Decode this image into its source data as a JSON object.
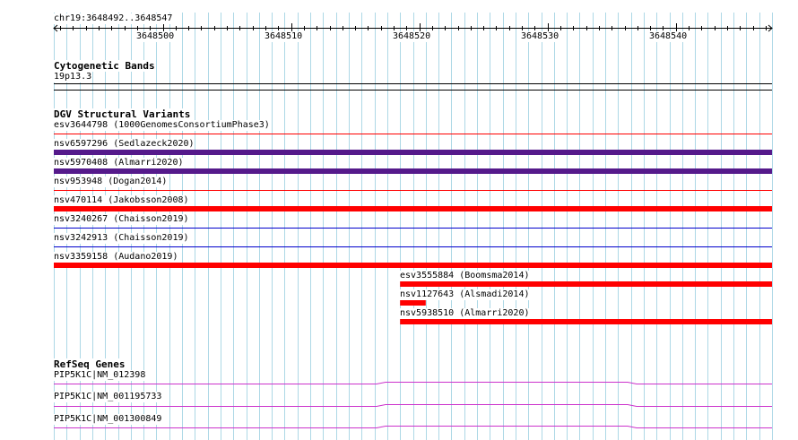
{
  "ruler": {
    "position_label": "chr19:3648492..3648547",
    "start": 3648492,
    "end": 3648547,
    "ticks": [
      "3648500",
      "3648510",
      "3648520",
      "3648530",
      "3648540"
    ]
  },
  "tracks": {
    "cytoband": {
      "title": "Cytogenetic Bands",
      "band_label": "19p13.3"
    },
    "dgv": {
      "title": "DGV Structural Variants",
      "items": [
        {
          "label": "esv3644798 (1000GenomesConsortiumPhase3)",
          "color": "#ff0000",
          "style": "line",
          "start": 3648492,
          "end": 3648547
        },
        {
          "label": "nsv6597296 (Sedlazeck2020)",
          "color": "#551a8b",
          "style": "bar",
          "start": 3648492,
          "end": 3648547
        },
        {
          "label": "nsv5970408 (Almarri2020)",
          "color": "#551a8b",
          "style": "bar",
          "start": 3648492,
          "end": 3648547
        },
        {
          "label": "nsv953948 (Dogan2014)",
          "color": "#ff0000",
          "style": "line",
          "start": 3648492,
          "end": 3648547
        },
        {
          "label": "nsv470114 (Jakobsson2008)",
          "color": "#ff0000",
          "style": "bar",
          "start": 3648492,
          "end": 3648547
        },
        {
          "label": "nsv3240267 (Chaisson2019)",
          "color": "#0000cc",
          "style": "line",
          "start": 3648492,
          "end": 3648547
        },
        {
          "label": "nsv3242913 (Chaisson2019)",
          "color": "#0000cc",
          "style": "line",
          "start": 3648492,
          "end": 3648547
        },
        {
          "label": "nsv3359158 (Audano2019)",
          "color": "#ff0000",
          "style": "bar",
          "start": 3648492,
          "end": 3648547
        },
        {
          "label": "esv3555884 (Boomsma2014)",
          "color": "#ff0000",
          "style": "bar",
          "start": 3648519,
          "end": 3648547
        },
        {
          "label": "nsv1127643 (Alsmadi2014)",
          "color": "#ff0000",
          "style": "bar",
          "start": 3648519,
          "end": 3648520
        },
        {
          "label": "nsv5938510 (Almarri2020)",
          "color": "#ff0000",
          "style": "bar",
          "start": 3648519,
          "end": 3648547
        }
      ]
    },
    "refseq": {
      "title": "RefSeq Genes",
      "color": "#cc33cc",
      "items": [
        {
          "label": "PIP5K1C|NM_012398"
        },
        {
          "label": "PIP5K1C|NM_001195733"
        },
        {
          "label": "PIP5K1C|NM_001300849"
        }
      ]
    }
  },
  "colors": {
    "grid": "#add8e6",
    "ruler": "#000000"
  }
}
